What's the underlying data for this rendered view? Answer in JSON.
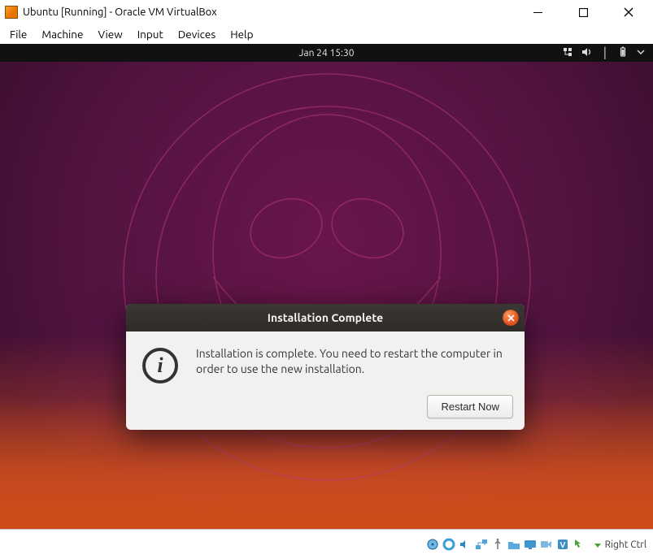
{
  "window": {
    "title": "Ubuntu [Running] - Oracle VM VirtualBox",
    "menu": {
      "file": "File",
      "machine": "Machine",
      "view": "View",
      "input": "Input",
      "devices": "Devices",
      "help": "Help"
    }
  },
  "gnome": {
    "clock": "Jan 24  15:30"
  },
  "dialog": {
    "title": "Installation Complete",
    "message": "Installation is complete. You need to restart the computer in order to use the new installation.",
    "button": "Restart Now"
  },
  "statusbar": {
    "hostkey": "Right Ctrl"
  }
}
